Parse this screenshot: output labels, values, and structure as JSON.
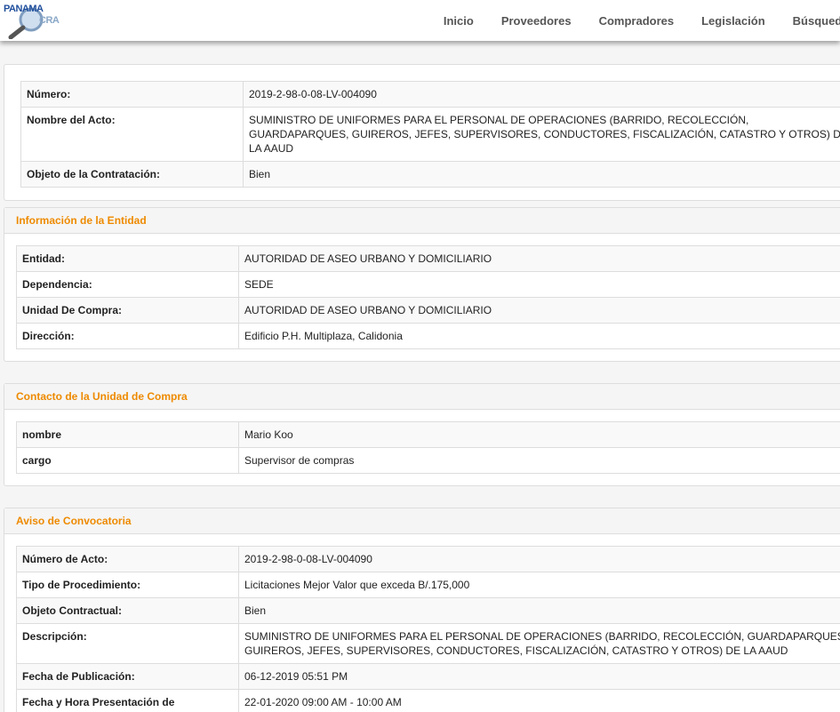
{
  "logo": {
    "top": "PANAMA",
    "bottom": "CRA"
  },
  "nav": [
    {
      "label": "Inicio"
    },
    {
      "label": "Proveedores"
    },
    {
      "label": "Compradores"
    },
    {
      "label": "Legislación"
    },
    {
      "label": "Búsqueda A"
    }
  ],
  "summary": {
    "rows": [
      {
        "label": "Número:",
        "value": "2019-2-98-0-08-LV-004090"
      },
      {
        "label": "Nombre del Acto:",
        "value": "SUMINISTRO DE UNIFORMES PARA EL PERSONAL DE OPERACIONES (BARRIDO, RECOLECCIÓN, GUARDAPARQUES, GUIREROS, JEFES, SUPERVISORES, CONDUCTORES, FISCALIZACIÓN, CATASTRO Y OTROS) DE LA AAUD"
      },
      {
        "label": "Objeto de la Contratación:",
        "value": "Bien"
      }
    ]
  },
  "entidad": {
    "title": "Información de la Entidad",
    "rows": [
      {
        "label": "Entidad:",
        "value": "AUTORIDAD DE ASEO URBANO Y DOMICILIARIO"
      },
      {
        "label": "Dependencia:",
        "value": "SEDE"
      },
      {
        "label": "Unidad De Compra:",
        "value": "AUTORIDAD DE ASEO URBANO Y DOMICILIARIO"
      },
      {
        "label": "Dirección:",
        "value": "Edificio P.H. Multiplaza, Calidonia"
      }
    ]
  },
  "contacto": {
    "title": "Contacto de la Unidad de Compra",
    "rows": [
      {
        "label": "nombre",
        "value": "Mario Koo"
      },
      {
        "label": "cargo",
        "value": "Supervisor de compras"
      }
    ]
  },
  "aviso": {
    "title": "Aviso de Convocatoria",
    "rows": [
      {
        "label": "Número de Acto:",
        "value": "2019-2-98-0-08-LV-004090"
      },
      {
        "label": "Tipo de Procedimiento:",
        "value": "Licitaciones Mejor Valor que exceda B/.175,000"
      },
      {
        "label": "Objeto Contractual:",
        "value": "Bien"
      },
      {
        "label": "Descripción:",
        "value": "SUMINISTRO DE UNIFORMES PARA EL PERSONAL DE OPERACIONES (BARRIDO, RECOLECCIÓN, GUARDAPARQUES, GUIREROS, JEFES, SUPERVISORES, CONDUCTORES, FISCALIZACIÓN, CATASTRO Y OTROS) DE LA AAUD"
      },
      {
        "label": "Fecha de Publicación:",
        "value": "06-12-2019 05:51 PM"
      },
      {
        "label": "Fecha y Hora Presentación de",
        "value": "22-01-2020 09:00 AM - 10:00 AM"
      }
    ]
  },
  "colors": {
    "accent": "#ee8a00",
    "border": "#dddddd",
    "logo_blue": "#1f4e9c"
  }
}
